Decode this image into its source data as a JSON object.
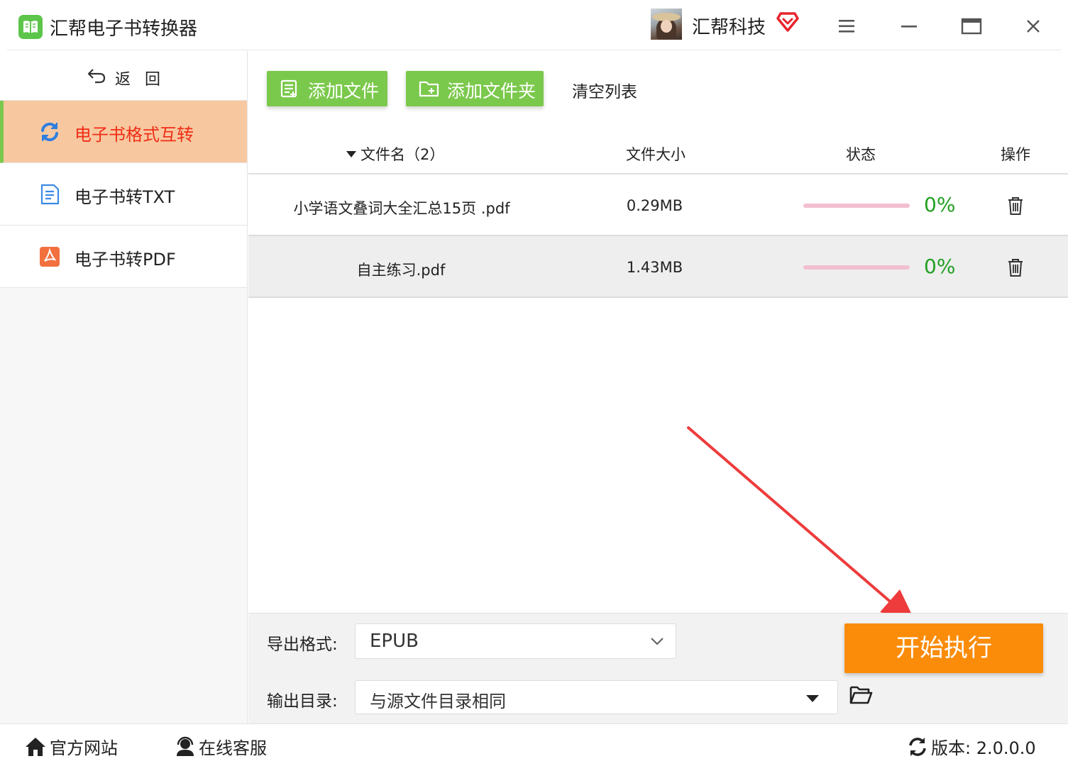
{
  "app": {
    "title": "汇帮电子书转换器",
    "username": "汇帮科技",
    "icons": {
      "logo": "book-icon",
      "vip": "diamond-icon",
      "menu": "menu-icon",
      "minimize": "minimize-icon",
      "maximize": "maximize-icon",
      "close": "close-icon"
    },
    "colors": {
      "brand_green": "#7bc94c",
      "active_bg": "#f7c8a0",
      "active_text": "#f02d16",
      "start": "#fa8c0a",
      "percent": "#22a022"
    }
  },
  "sidebar": {
    "back_label": "返回",
    "items": [
      {
        "label": "电子书格式互转",
        "icon": "convert-icon",
        "active": true
      },
      {
        "label": "电子书转TXT",
        "icon": "txt-doc-icon",
        "active": false
      },
      {
        "label": "电子书转PDF",
        "icon": "pdf-icon",
        "active": false
      }
    ]
  },
  "toolbar": {
    "add_file": "添加文件",
    "add_folder": "添加文件夹",
    "clear_list": "清空列表"
  },
  "table": {
    "headers": {
      "name": "文件名（2）",
      "size": "文件大小",
      "status": "状态",
      "action": "操作"
    },
    "rows": [
      {
        "name": "小学语文叠词大全汇总15页 .pdf",
        "size": "0.29MB",
        "progress": 0,
        "percent": "0%"
      },
      {
        "name": "自主练习.pdf",
        "size": "1.43MB",
        "progress": 0,
        "percent": "0%"
      }
    ]
  },
  "output": {
    "format_label": "导出格式:",
    "format_value": "EPUB",
    "dir_label": "输出目录:",
    "dir_value": "与源文件目录相同",
    "start_label": "开始执行"
  },
  "statusbar": {
    "website": "官方网站",
    "support": "在线客服",
    "version": "版本:  2.0.0.0"
  }
}
